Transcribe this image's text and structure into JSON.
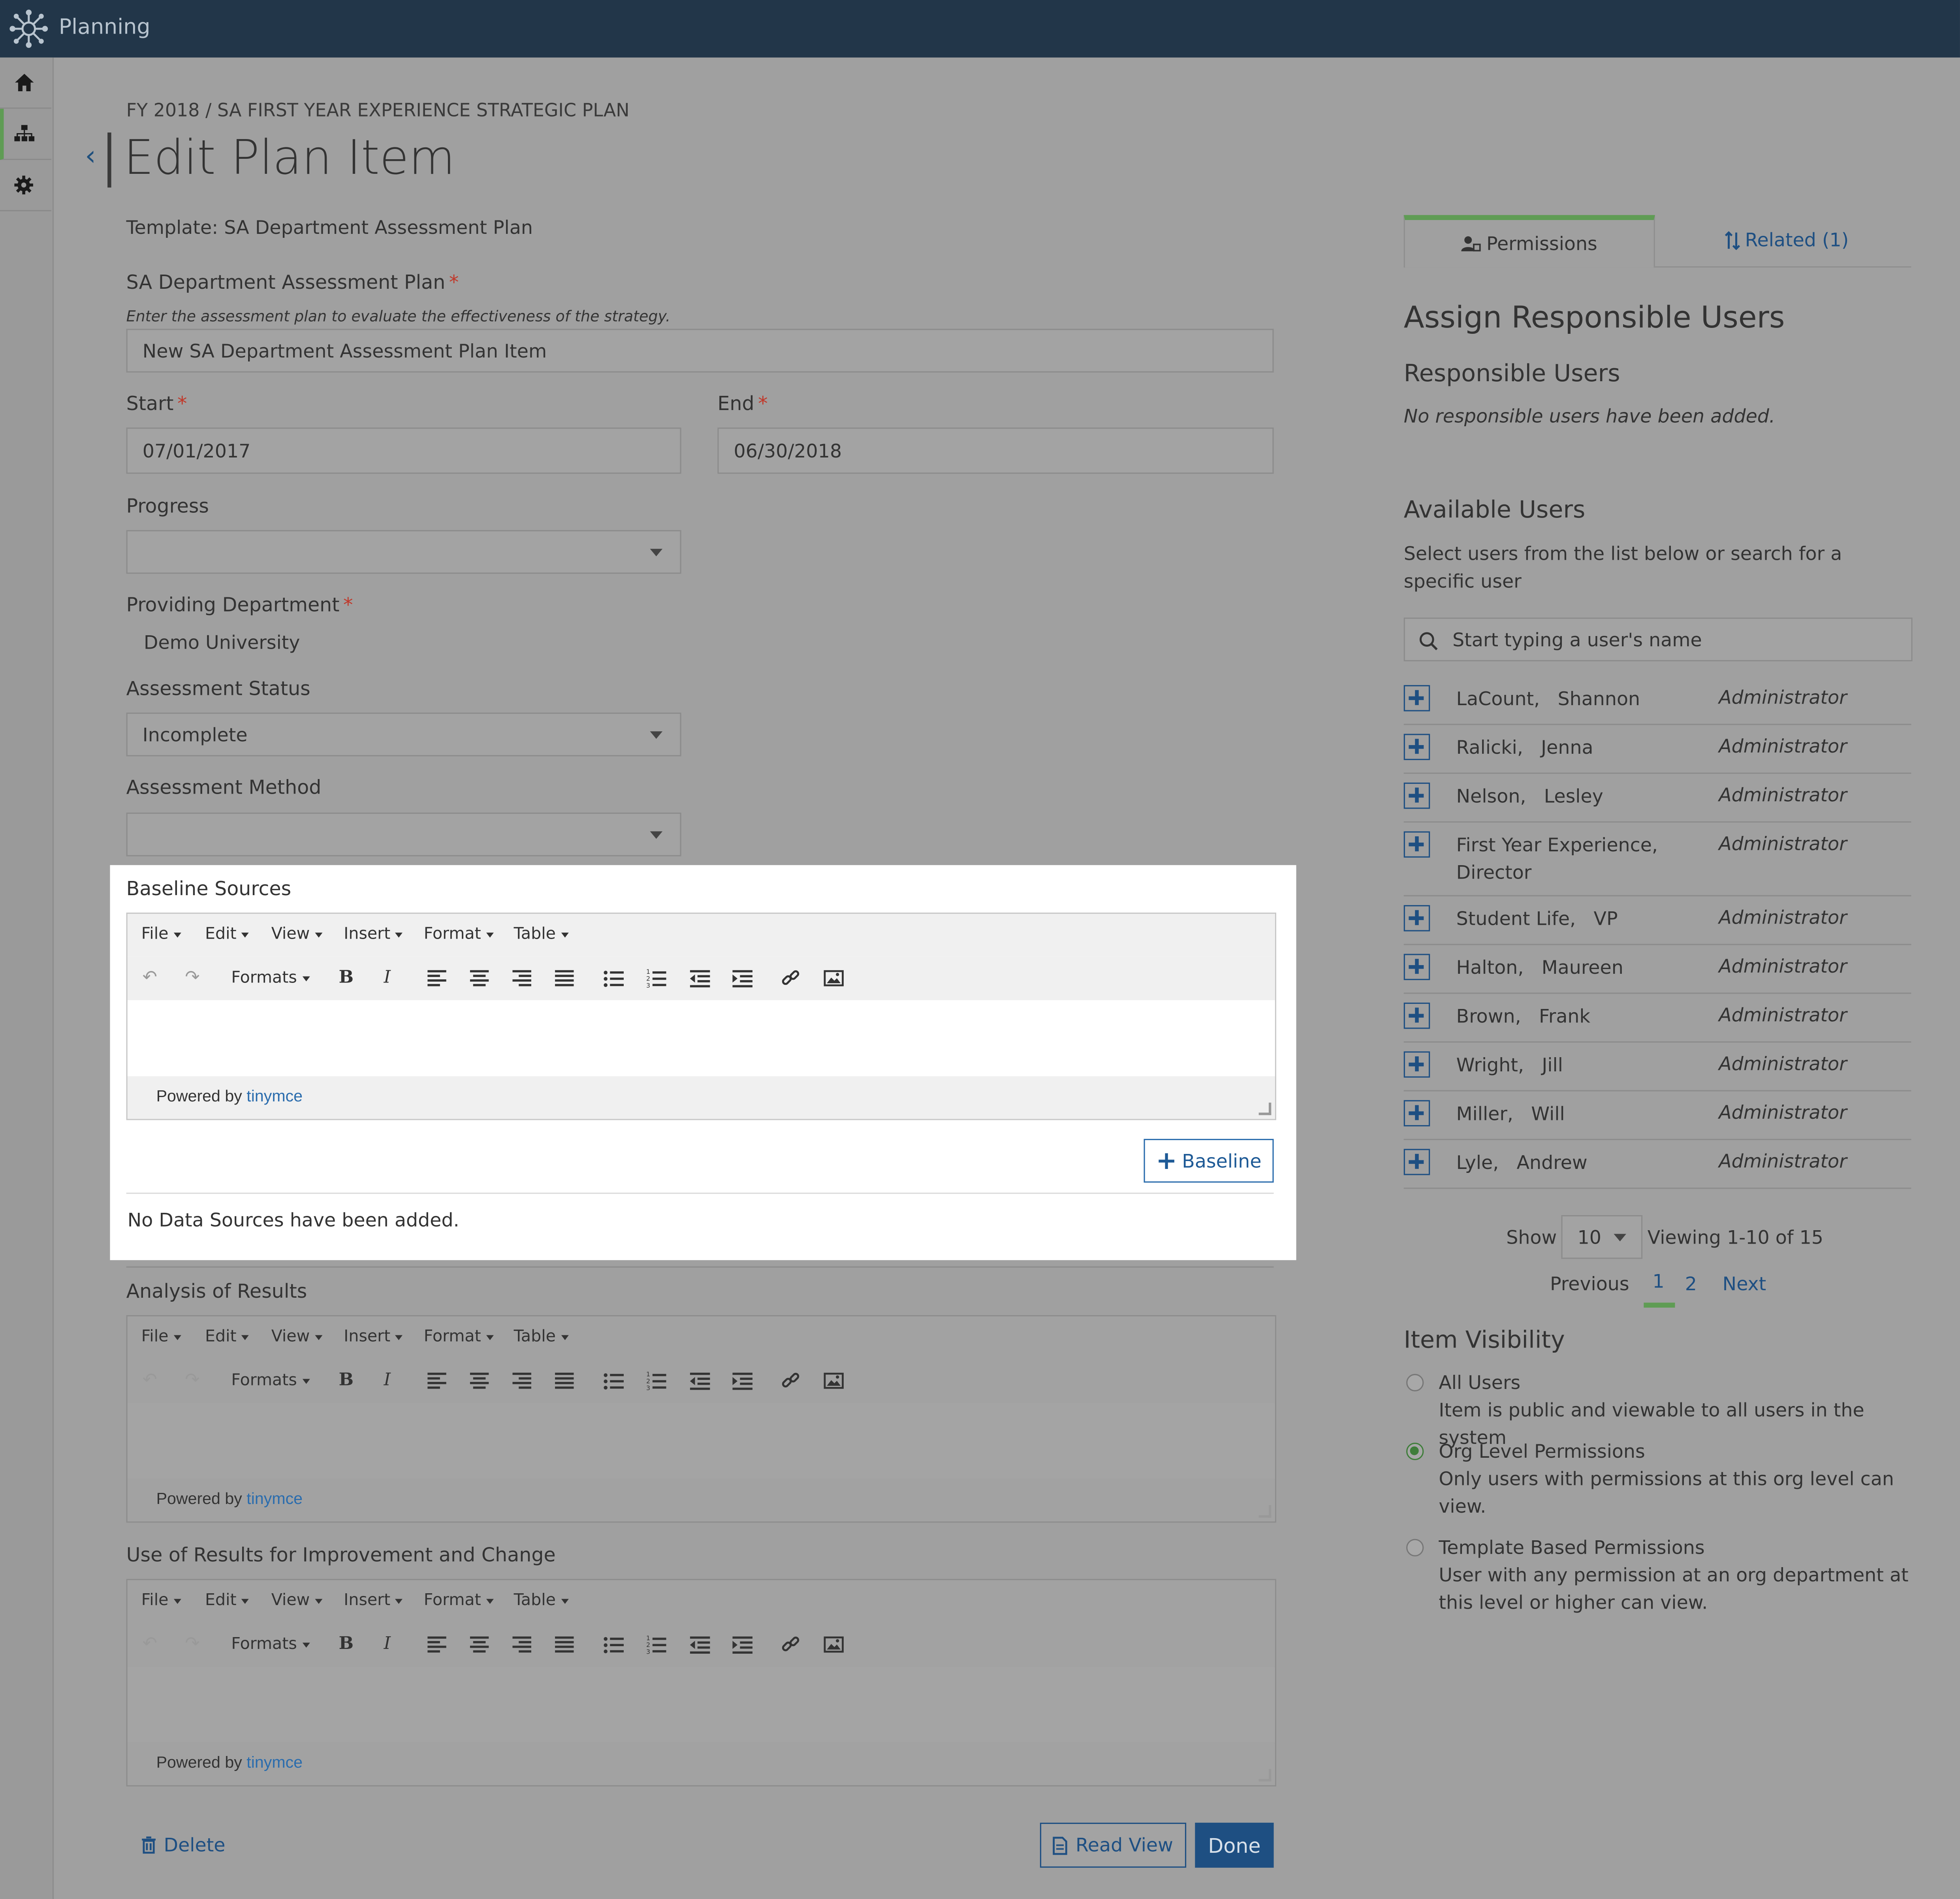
{
  "app": {
    "title": "Planning"
  },
  "breadcrumb": "FY 2018 / SA FIRST YEAR EXPERIENCE STRATEGIC PLAN",
  "page_title": "Edit Plan Item",
  "template_line": "Template: SA Department Assessment Plan",
  "form": {
    "plan_label": "SA Department Assessment Plan",
    "plan_hint": "Enter the assessment plan to evaluate the effectiveness of the strategy.",
    "plan_value": "New SA Department Assessment Plan Item",
    "start_label": "Start",
    "start_value": "07/01/2017",
    "end_label": "End",
    "end_value": "06/30/2018",
    "progress_label": "Progress",
    "progress_value": "",
    "dept_label": "Providing Department",
    "dept_value": "Demo University",
    "status_label": "Assessment Status",
    "status_value": "Incomplete",
    "method_label": "Assessment Method",
    "method_value": "",
    "required_mark": "*"
  },
  "editor": {
    "menus": [
      "File",
      "Edit",
      "View",
      "Insert",
      "Format",
      "Table"
    ],
    "formats_label": "Formats",
    "powered_by": "Powered by",
    "powered_link": "tinymce"
  },
  "baseline": {
    "label": "Baseline Sources",
    "add_button": "Baseline",
    "empty_text": "No Data Sources have been added."
  },
  "analysis_label": "Analysis of Results",
  "use_label": "Use of Results for Improvement and Change",
  "footer": {
    "delete": "Delete",
    "read_view": "Read View",
    "done": "Done"
  },
  "tabs": {
    "permissions": "Permissions",
    "related": "Related (1)"
  },
  "right": {
    "assign_title": "Assign Responsible Users",
    "responsible_title": "Responsible Users",
    "responsible_empty": "No responsible users have been added.",
    "available_title": "Available Users",
    "available_desc": "Select users from the list below or search for a specific user",
    "search_placeholder": "Start typing a user's name"
  },
  "users": [
    {
      "name": "LaCount,   Shannon",
      "role": "Administrator"
    },
    {
      "name": "Ralicki,   Jenna",
      "role": "Administrator"
    },
    {
      "name": "Nelson,   Lesley",
      "role": "Administrator"
    },
    {
      "name": "First Year Experience,   Director",
      "role": "Administrator"
    },
    {
      "name": "Student Life,   VP",
      "role": "Administrator"
    },
    {
      "name": "Halton,   Maureen",
      "role": "Administrator"
    },
    {
      "name": "Brown,   Frank",
      "role": "Administrator"
    },
    {
      "name": "Wright,   Jill",
      "role": "Administrator"
    },
    {
      "name": "Miller,   Will",
      "role": "Administrator"
    },
    {
      "name": "Lyle,   Andrew",
      "role": "Administrator"
    }
  ],
  "pager": {
    "show_label": "Show",
    "page_size": "10",
    "viewing": "Viewing 1-10 of 15",
    "previous": "Previous",
    "page1": "1",
    "page2": "2",
    "next": "Next"
  },
  "visibility": {
    "title": "Item Visibility",
    "selected": "Org Level Permissions",
    "options": [
      {
        "label": "All Users",
        "desc": "Item is public and viewable to all users in the system"
      },
      {
        "label": "Org Level Permissions",
        "desc": "Only users with permissions at this org level can view."
      },
      {
        "label": "Template Based Permissions",
        "desc": "User with any permission at an org department at this level or higher can view."
      }
    ]
  },
  "colors": {
    "topbar": "#223649",
    "accent_green": "#5f9c54",
    "link_blue": "#1e4f82",
    "required_red": "#c0392b"
  },
  "icons": [
    "network-logo-icon",
    "home-icon",
    "org-chart-icon",
    "gear-icon",
    "chevron-left-icon",
    "user-lock-icon",
    "sort-icon",
    "search-icon",
    "plus-icon",
    "trash-icon",
    "document-icon"
  ]
}
